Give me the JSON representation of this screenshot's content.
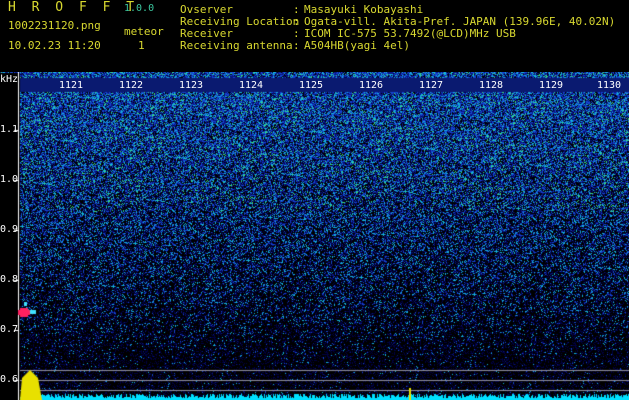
{
  "header": {
    "title": "H R O F F T",
    "version": "1.0.0",
    "file_name": "1002231120.png",
    "meteor_label": "meteor",
    "meteor_count": "1",
    "datetime": "10.02.23 11:20"
  },
  "station": [
    {
      "label": "Ovserver",
      "value": "Masayuki Kobayashi"
    },
    {
      "label": "Receiving Location",
      "value": "Ogata-vill. Akita-Pref. JAPAN (139.96E, 40.02N)"
    },
    {
      "label": "Receiver",
      "value": "ICOM IC-575 53.7492(@LCD)MHz USB"
    },
    {
      "label": "Receiving antenna",
      "value": "A504HB(yagi 4el)"
    }
  ],
  "colon": ":",
  "axis": {
    "y_unit": "kHz",
    "y_ticks": [
      "1.1",
      "1.0",
      "0.9",
      "0.8",
      "0.7",
      "0.6"
    ],
    "time_ticks": [
      "1121",
      "1122",
      "1123",
      "1124",
      "1125",
      "1126",
      "1127",
      "1128",
      "1129",
      "1130"
    ]
  },
  "colors": {
    "header_text": "#d8d830",
    "version_text": "#3cc8a0",
    "meteor_echo": "#ff2060",
    "noise_floor": "#00e0ff"
  }
}
